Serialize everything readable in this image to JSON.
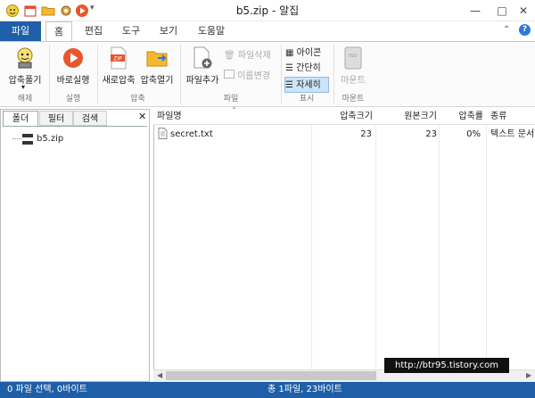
{
  "window": {
    "title": "b5.zip - 알집"
  },
  "quick_access": [
    "smiley-icon",
    "calendar-icon",
    "folder-icon",
    "gear-icon",
    "play-icon"
  ],
  "window_controls": {
    "minimize": "—",
    "maximize": "□",
    "close": "✕"
  },
  "tabs": [
    {
      "label": "파일",
      "active": false
    },
    {
      "label": "홈",
      "active": true
    },
    {
      "label": "편집",
      "active": false
    },
    {
      "label": "도구",
      "active": false
    },
    {
      "label": "보기",
      "active": false
    },
    {
      "label": "도움말",
      "active": false
    }
  ],
  "ribbon": {
    "extract": {
      "label": "압축풀기",
      "group": "해제"
    },
    "run": {
      "label": "바로실행",
      "group": "실행"
    },
    "new_zip": {
      "label": "새로압축",
      "badge": "ZIP"
    },
    "open_zip": {
      "label": "압축열기",
      "group": "압축"
    },
    "add_file": {
      "label": "파일추가"
    },
    "delete_file": {
      "label": "파일삭제"
    },
    "rename": {
      "label": "이름변경",
      "group": "파일"
    },
    "view_icon": {
      "label": "아이콘"
    },
    "view_list": {
      "label": "간단히"
    },
    "view_detail": {
      "label": "자세히",
      "group": "표시"
    },
    "mount": {
      "label": "마운트",
      "group": "마운트",
      "badge": "ISO"
    }
  },
  "left_panel": {
    "tabs": [
      "폴더",
      "필터",
      "검색"
    ],
    "tree_root": "b5.zip",
    "close": "✕"
  },
  "columns": [
    "파일명",
    "압축크기",
    "원본크기",
    "압축률",
    "종류"
  ],
  "files": [
    {
      "name": "secret.txt",
      "compressed": "23",
      "original": "23",
      "ratio": "0%",
      "type": "텍스트 문서"
    }
  ],
  "watermark": "http://btr95.tistory.com",
  "status": {
    "left": "0 파일 선택, 0바이트",
    "center": "총 1파일, 23바이트"
  },
  "colors": {
    "accent": "#1f5fa8",
    "selected": "#cde3f7"
  }
}
